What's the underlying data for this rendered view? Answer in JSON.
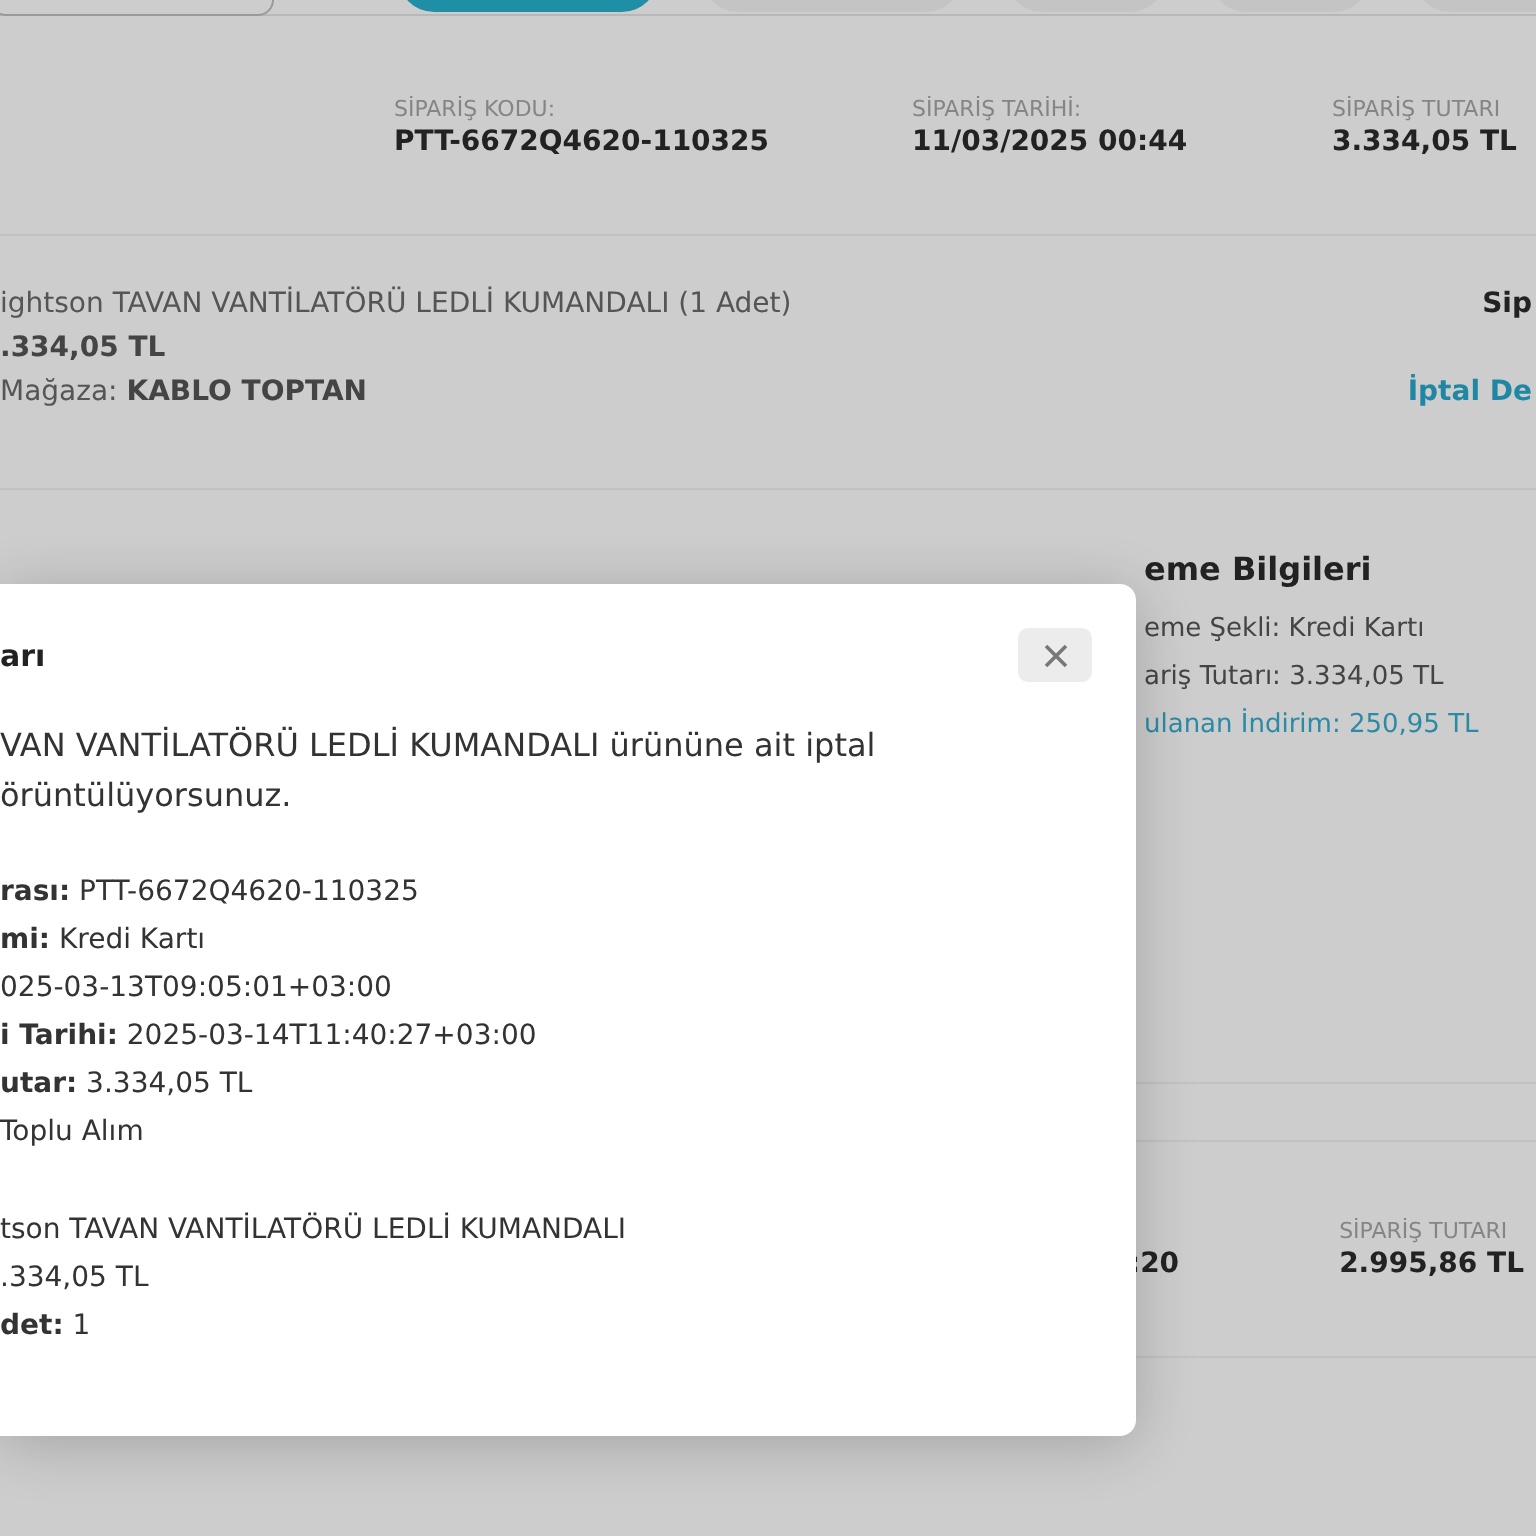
{
  "tabs": [
    {
      "kind": "outline",
      "selected": false
    },
    {
      "kind": "pill",
      "selected": true
    },
    {
      "kind": "pill",
      "selected": false
    },
    {
      "kind": "short",
      "selected": false
    },
    {
      "kind": "short",
      "selected": false
    },
    {
      "kind": "pill",
      "selected": false
    }
  ],
  "order": {
    "fields": [
      {
        "label": "SİPARİŞ KODU:",
        "value": "PTT-6672Q4620-110325"
      },
      {
        "label": "SİPARİŞ TARİHİ:",
        "value": "11/03/2025 00:44"
      },
      {
        "label": "SİPARİŞ TUTARI",
        "value": "3.334,05 TL"
      }
    ],
    "product": {
      "name": "ightson TAVAN VANTİLATÖRÜ LEDLİ KUMANDALI (1 Adet)",
      "price": ".334,05 TL",
      "store_label": "Mağaza:",
      "store": "KABLO TOPTAN"
    },
    "side_label": "Sip",
    "cancel_link": "İptal De",
    "payment": {
      "title": "eme Bilgileri",
      "lines": [
        {
          "text": "eme Şekli: Kredi Kartı",
          "kind": "plain"
        },
        {
          "text": "ariş Tutarı: 3.334,05 TL",
          "kind": "plain"
        },
        {
          "text": "ulanan İndirim: 250,95 TL",
          "kind": "discount"
        }
      ]
    }
  },
  "next_order": {
    "date_fragment": ":20",
    "total_label": "SİPARİŞ TUTARI",
    "total": "2.995,86 TL"
  },
  "modal": {
    "title": "arı",
    "intro": [
      "VAN VANTİLATÖRÜ LEDLİ KUMANDALI ürününe ait iptal",
      "örüntülüyorsunuz."
    ],
    "details": [
      "**rası:** PTT-6672Q4620-110325",
      "**mi:** Kredi Kartı",
      "025-03-13T09:05:01+03:00",
      "**i Tarihi:** 2025-03-14T11:40:27+03:00",
      "**utar:** 3.334,05 TL",
      "Toplu Alım"
    ],
    "item": [
      "tson TAVAN VANTİLATÖRÜ LEDLİ KUMANDALI",
      ".334,05 TL",
      "**det:** 1"
    ]
  }
}
